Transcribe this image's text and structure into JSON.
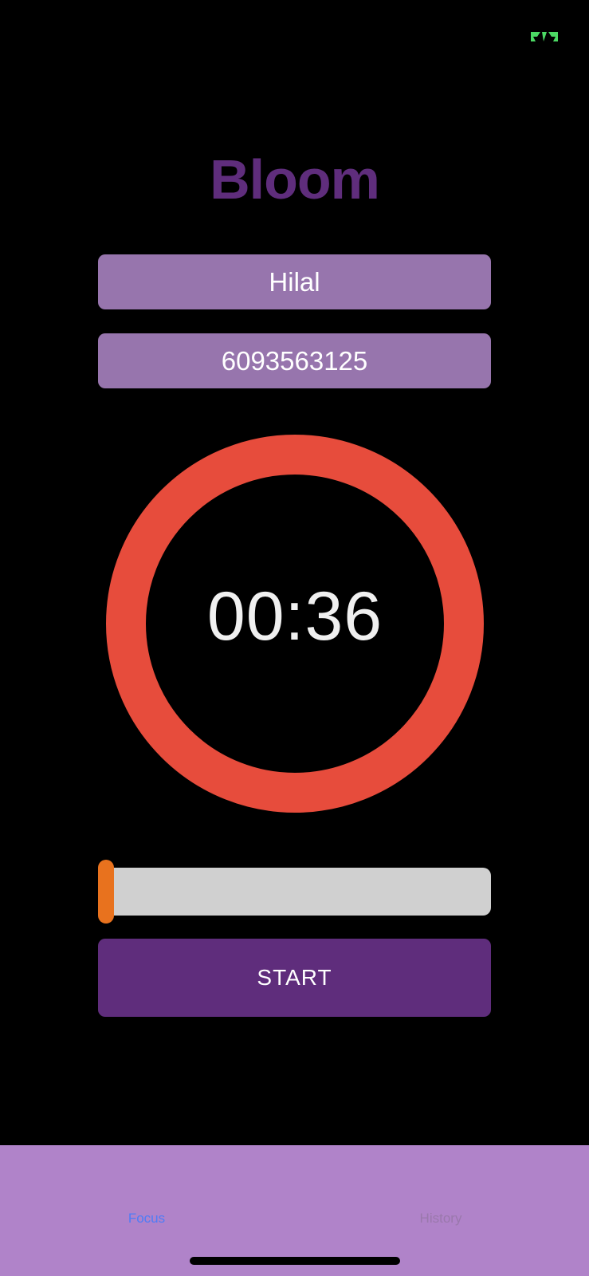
{
  "status_bar": {
    "battery_icon": "battery-charging-icon"
  },
  "app": {
    "title": "Bloom"
  },
  "form": {
    "name_value": "Hilal",
    "phone_value": "6093563125"
  },
  "timer": {
    "display": "00:36",
    "ring_color": "#e74c3c"
  },
  "slider": {
    "level": 0.0,
    "thumb_color": "#e8721e"
  },
  "actions": {
    "start_label": "START"
  },
  "tab_bar": {
    "tabs": [
      {
        "label": "Focus",
        "active": true
      },
      {
        "label": "History",
        "active": false
      }
    ]
  },
  "colors": {
    "accent": "#5f2d7c",
    "field_bg": "#9775ad",
    "tab_bar_bg": "#b083c9",
    "tab_active": "#4f7cf6"
  }
}
